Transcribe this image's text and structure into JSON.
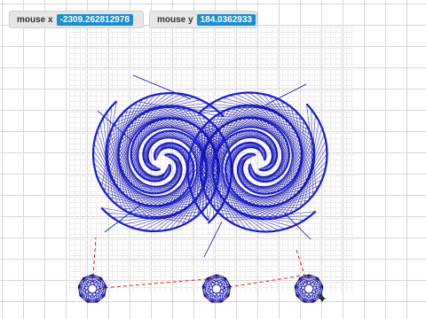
{
  "monitors": {
    "x": {
      "label": "mouse x",
      "value": "-2309.262812978"
    },
    "y": {
      "label": "mouse y",
      "value": "184.0362933"
    }
  },
  "colors": {
    "stroke": "#1010b0",
    "dashed_link": "#e02020",
    "grid": "#d6d6d6",
    "monitor_value_bg": "#1a8fd0",
    "monitor_bg": "#e6e6e6"
  },
  "cursor_icon": "crosshair-star-icon"
}
